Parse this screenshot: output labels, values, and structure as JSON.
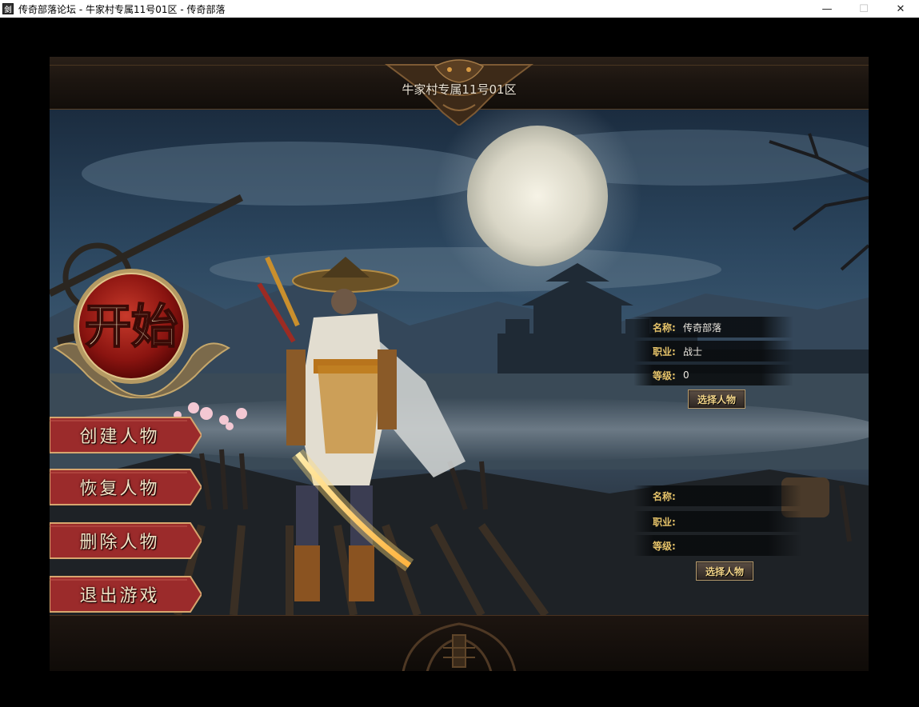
{
  "window": {
    "title": "传奇部落论坛 - 牛家村专属11号01区 - 传奇部落",
    "app_icon_text": "剑",
    "minimize_glyph": "—",
    "maximize_glyph": "☐",
    "close_glyph": "✕"
  },
  "game": {
    "server_name": "牛家村专属11号01区",
    "start_button": {
      "label": "开始"
    },
    "menu": [
      {
        "label": "创建人物"
      },
      {
        "label": "恢复人物"
      },
      {
        "label": "删除人物"
      },
      {
        "label": "退出游戏"
      }
    ],
    "slots": [
      {
        "name_label": "名称:",
        "name_value": "传奇部落",
        "class_label": "职业:",
        "class_value": "战士",
        "level_label": "等级:",
        "level_value": "0",
        "select_label": "选择人物"
      },
      {
        "name_label": "名称:",
        "name_value": "",
        "class_label": "职业:",
        "class_value": "",
        "level_label": "等级:",
        "level_value": "",
        "select_label": "选择人物"
      }
    ]
  },
  "colors": {
    "menu_red": "#9b2b2b",
    "gold_text": "#e7c46a",
    "button_border": "#b59a6c"
  }
}
